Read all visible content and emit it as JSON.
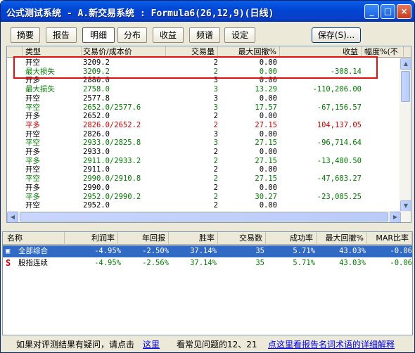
{
  "window": {
    "title": "公式测试系统 - A.新交易系统 : Formula6(26,12,9)(日线)",
    "buttons": {
      "minimize": "_",
      "maximize": "□",
      "close": "×"
    }
  },
  "toolbar": {
    "tabs": [
      "摘要",
      "报告",
      "明细",
      "分布",
      "收益",
      "频谱",
      "设定"
    ],
    "active_tab": "明细",
    "save_label": "保存(S)..."
  },
  "detail_table": {
    "columns": [
      "类型",
      "交易价/成本价",
      "交易量",
      "最大回撤%",
      "收益",
      "幅度%(不"
    ],
    "rows": [
      {
        "type": "开空",
        "price": "3209.2",
        "qty": "2",
        "drawdown": "0.00",
        "profit": "",
        "color": "black"
      },
      {
        "type": "最大损失",
        "price": "3209.2",
        "qty": "2",
        "drawdown": "0.00",
        "profit": "-308.14",
        "color": "green"
      },
      {
        "type": "开多",
        "price": "2880.0",
        "qty": "3",
        "drawdown": "0.00",
        "profit": "",
        "color": "black"
      },
      {
        "type": "最大损失",
        "price": "2758.0",
        "qty": "3",
        "drawdown": "13.29",
        "profit": "-110,206.00",
        "color": "green"
      },
      {
        "type": "开空",
        "price": "2577.8",
        "qty": "3",
        "drawdown": "0.00",
        "profit": "",
        "color": "black"
      },
      {
        "type": "平空",
        "price": "2652.0/2577.6",
        "qty": "3",
        "drawdown": "17.57",
        "profit": "-67,156.57",
        "color": "green"
      },
      {
        "type": "开多",
        "price": "2652.0",
        "qty": "2",
        "drawdown": "0.00",
        "profit": "",
        "color": "black"
      },
      {
        "type": "平多",
        "price": "2826.0/2652.2",
        "qty": "2",
        "drawdown": "27.15",
        "profit": "104,137.05",
        "color": "red"
      },
      {
        "type": "开空",
        "price": "2826.0",
        "qty": "3",
        "drawdown": "0.00",
        "profit": "",
        "color": "black"
      },
      {
        "type": "平空",
        "price": "2933.0/2825.8",
        "qty": "3",
        "drawdown": "27.15",
        "profit": "-96,714.64",
        "color": "green"
      },
      {
        "type": "开多",
        "price": "2933.0",
        "qty": "2",
        "drawdown": "0.00",
        "profit": "",
        "color": "black"
      },
      {
        "type": "平多",
        "price": "2911.0/2933.2",
        "qty": "2",
        "drawdown": "27.15",
        "profit": "-13,480.50",
        "color": "green"
      },
      {
        "type": "开空",
        "price": "2911.0",
        "qty": "2",
        "drawdown": "0.00",
        "profit": "",
        "color": "black"
      },
      {
        "type": "平空",
        "price": "2990.0/2910.8",
        "qty": "2",
        "drawdown": "27.15",
        "profit": "-47,683.27",
        "color": "green"
      },
      {
        "type": "开多",
        "price": "2990.0",
        "qty": "2",
        "drawdown": "0.00",
        "profit": "",
        "color": "black"
      },
      {
        "type": "平多",
        "price": "2952.0/2990.2",
        "qty": "2",
        "drawdown": "30.27",
        "profit": "-23,085.25",
        "color": "green"
      },
      {
        "type": "开空",
        "price": "2952.0",
        "qty": "2",
        "drawdown": "0.00",
        "profit": "",
        "color": "black"
      }
    ]
  },
  "summary_table": {
    "columns": [
      "名称",
      "利润率",
      "年回报",
      "胜率",
      "交易数",
      "成功率",
      "最大回撤%",
      "MAR比率"
    ],
    "rows": [
      {
        "icon": "folder-icon",
        "name": "全部综合",
        "profit_rate": "-4.95%",
        "annual": "-2.50%",
        "win": "37.14%",
        "trades": "35",
        "success": "5.71%",
        "drawdown": "43.03%",
        "mar": "-0.06",
        "selected": true
      },
      {
        "icon": "S",
        "name": "股指连续",
        "profit_rate": "-4.95%",
        "annual": "-2.56%",
        "win": "37.14%",
        "trades": "35",
        "success": "5.71%",
        "drawdown": "43.03%",
        "mar": "-0.06",
        "selected": false
      }
    ]
  },
  "footer": {
    "question_text": "如果对评测结果有疑问，请点击",
    "here_link": "这里",
    "faq_text": "看常见问题的12、21",
    "glossary_link": "点这里看报告名词术语的详细解释"
  },
  "colors": {
    "profit": "#d00000",
    "loss": "#007d00",
    "selection": "#316ac5",
    "highlight": "#e01010"
  }
}
